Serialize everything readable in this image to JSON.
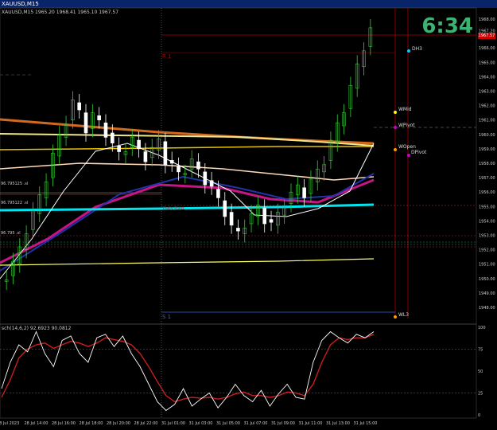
{
  "window": {
    "title": "XAUUSD,M15"
  },
  "chart_info": "XAUUSD,M15  1965.20 1968.41 1965.10 1967.57",
  "clock": "6:34",
  "current_price": "1967.57",
  "price_axis": [
    "1968.00",
    "1967.20",
    "1966.00",
    "1965.00",
    "1964.00",
    "1963.00",
    "1962.00",
    "1961.00",
    "1960.00",
    "1959.00",
    "1958.00",
    "1957.00",
    "1956.00",
    "1955.00",
    "1954.00",
    "1953.00",
    "1952.00",
    "1951.00",
    "1950.00",
    "1949.00",
    "1948.00"
  ],
  "time_axis": [
    "28 Jul 2023",
    "28 Jul 14:00",
    "28 Jul 16:00",
    "28 Jul 18:00",
    "28 Jul 20:00",
    "28 Jul 22:00",
    "31 Jul 01:00",
    "31 Jul 03:00",
    "31 Jul 05:00",
    "31 Jul 07:00",
    "31 Jul 09:00",
    "31 Jul 11:00",
    "31 Jul 13:00",
    "31 Jul 15:00"
  ],
  "levels": {
    "r1": "R 1",
    "s1": "S 1",
    "daily_pivot": "Daily Pivot",
    "dh3": "DH3",
    "wmid": "WMid",
    "wpivot": "WPivot",
    "wopen": "WOpen",
    "dpivot": "DPivot",
    "wl3": "WL3"
  },
  "left_labels": [
    "96.795125 .sl",
    "96.795122 .sl",
    "96.795 .sl"
  ],
  "indicator": {
    "label": "sch(14,6,2) 92.6923 90.0812",
    "scale": [
      "100",
      "75",
      "50",
      "25",
      "0"
    ]
  },
  "colors": {
    "bull": "#32cd32",
    "bear": "#ffffff",
    "grid": "#555"
  }
}
